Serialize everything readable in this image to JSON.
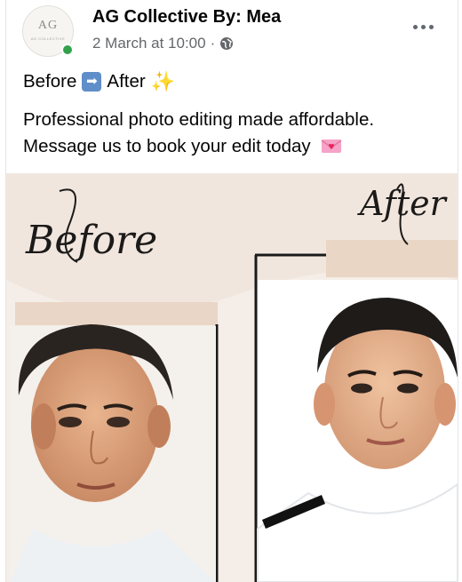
{
  "post": {
    "author": "AG Collective By: Mea",
    "timestamp": "2 March at 10:00",
    "separator": "·",
    "privacy_icon": "globe-icon",
    "more_icon": "more-options-icon",
    "line1_before": "Before",
    "line1_after": "After",
    "arrow_emoji": "➡",
    "sparkle_emoji": "✨",
    "message": "Professional photo editing made affordable. Message us to book your edit today"
  },
  "avatar": {
    "monogram": "AG",
    "tagline": "AG COLLECTIVE",
    "online_color": "#31a24c"
  },
  "image": {
    "before_label": "Before",
    "after_label": "After"
  }
}
